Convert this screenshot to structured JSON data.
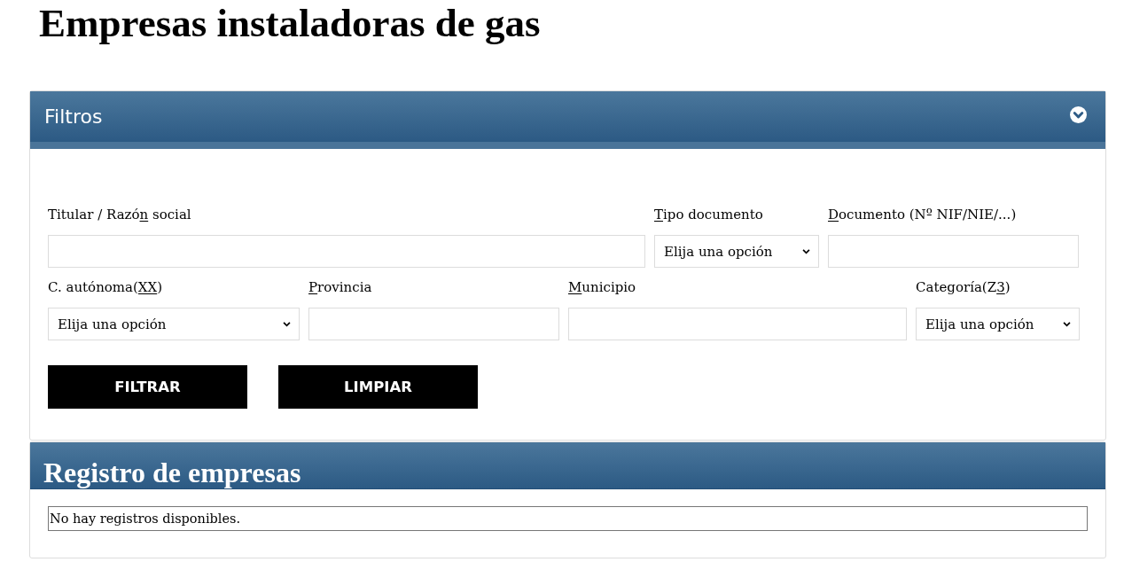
{
  "page_title": "Empresas instaladoras de gas",
  "filters_panel": {
    "title": "Filtros",
    "fields": [
      {
        "kind": "text",
        "label": [
          {
            "text": "Titular / Razó",
            "underlined": false
          },
          {
            "text": "n",
            "underlined": true
          },
          {
            "text": " social",
            "underlined": false
          }
        ]
      },
      {
        "kind": "select",
        "label": [
          {
            "text": "T",
            "underlined": true
          },
          {
            "text": "ipo documento",
            "underlined": false
          }
        ],
        "value": "Elija una opción"
      },
      {
        "kind": "text",
        "label": [
          {
            "text": "D",
            "underlined": true
          },
          {
            "text": "ocumento (Nº NIF/NIE/...)",
            "underlined": false
          }
        ]
      },
      {
        "kind": "select",
        "label": [
          {
            "text": "C. autónoma(",
            "underlined": false
          },
          {
            "text": "XX",
            "underlined": true
          },
          {
            "text": ")",
            "underlined": false
          }
        ],
        "value": "Elija una opción"
      },
      {
        "kind": "text",
        "label": [
          {
            "text": "P",
            "underlined": true
          },
          {
            "text": "rovincia",
            "underlined": false
          }
        ]
      },
      {
        "kind": "text",
        "label": [
          {
            "text": "M",
            "underlined": true
          },
          {
            "text": "unicipio",
            "underlined": false
          }
        ]
      },
      {
        "kind": "select",
        "label": [
          {
            "text": "Categoría(Z",
            "underlined": false
          },
          {
            "text": "3",
            "underlined": true
          },
          {
            "text": ")",
            "underlined": false
          }
        ],
        "value": "Elija una opción"
      }
    ],
    "buttons": [
      {
        "label": "FILTRAR"
      },
      {
        "label": "LIMPIAR"
      }
    ]
  },
  "results_panel": {
    "title": "Registro de empresas",
    "message": "No hay registros disponibles."
  }
}
